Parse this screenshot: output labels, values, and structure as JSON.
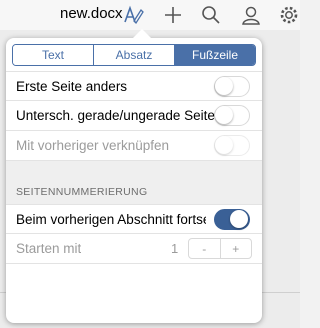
{
  "topbar": {
    "title": "new.docx",
    "icons": [
      "format-icon",
      "add-icon",
      "search-icon",
      "user-icon",
      "settings-icon"
    ]
  },
  "popover": {
    "tabs": [
      {
        "label": "Text",
        "active": false
      },
      {
        "label": "Absatz",
        "active": false
      },
      {
        "label": "Fußzeile",
        "active": true
      }
    ],
    "options": [
      {
        "label": "Erste Seite anders",
        "on": false,
        "disabled": false
      },
      {
        "label": "Untersch. gerade/ungerade Seiten",
        "on": false,
        "disabled": false
      },
      {
        "label": "Mit vorheriger verknüpfen",
        "on": false,
        "disabled": true
      }
    ],
    "numbering": {
      "header": "SEITENNUMMERIERUNG",
      "continue_label": "Beim vorherigen Abschnitt fortset...",
      "continue_on": true,
      "start_label": "Starten mit",
      "start_value": "1",
      "minus": "-",
      "plus": "+"
    }
  },
  "colors": {
    "accent": "#4a70a8",
    "toggle_on": "#3a6096"
  }
}
